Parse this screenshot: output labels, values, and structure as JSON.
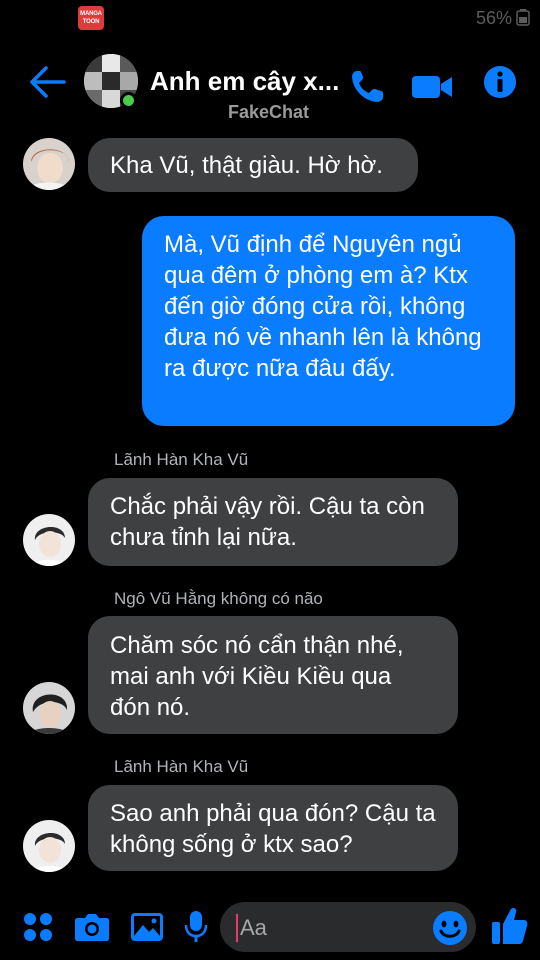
{
  "status": {
    "app_badge": "MANGA TOON",
    "battery": "56%"
  },
  "header": {
    "title": "Anh em cây x...",
    "subtitle": "FakeChat"
  },
  "messages": [
    {
      "direction": "in",
      "text": "Kha Vũ, thật giàu. Hờ hờ.",
      "sender": ""
    },
    {
      "direction": "out",
      "text": "Mà, Vũ định để Nguyên ngủ qua đêm ở phòng em à? Ktx đến giờ đóng cửa rồi, không đưa nó về nhanh lên là không ra được nữa đâu đấy."
    },
    {
      "direction": "in",
      "sender": "Lãnh Hàn Kha Vũ",
      "text": "Chắc phải vậy rồi. Cậu ta còn chưa tỉnh lại nữa."
    },
    {
      "direction": "in",
      "sender": "Ngô Vũ Hằng không có não",
      "text": "Chăm sóc nó cẩn thận nhé, mai anh với Kiều Kiều qua đón nó."
    },
    {
      "direction": "in",
      "sender": "Lãnh Hàn Kha Vũ",
      "text": "Sao anh phải qua đón? Cậu ta không sống ở ktx sao?"
    }
  ],
  "composer": {
    "placeholder": "Aa"
  },
  "icons": {
    "back": "arrow-left-icon",
    "phone": "phone-icon",
    "video": "video-camera-icon",
    "info": "info-icon",
    "menu": "four-dots-icon",
    "camera": "camera-icon",
    "gallery": "image-icon",
    "mic": "microphone-icon",
    "emoji": "smiley-icon",
    "like": "thumbs-up-icon"
  },
  "colors": {
    "accent": "#0a7cff",
    "incoming_bubble": "#3e4042",
    "online": "#4bcb4b"
  }
}
